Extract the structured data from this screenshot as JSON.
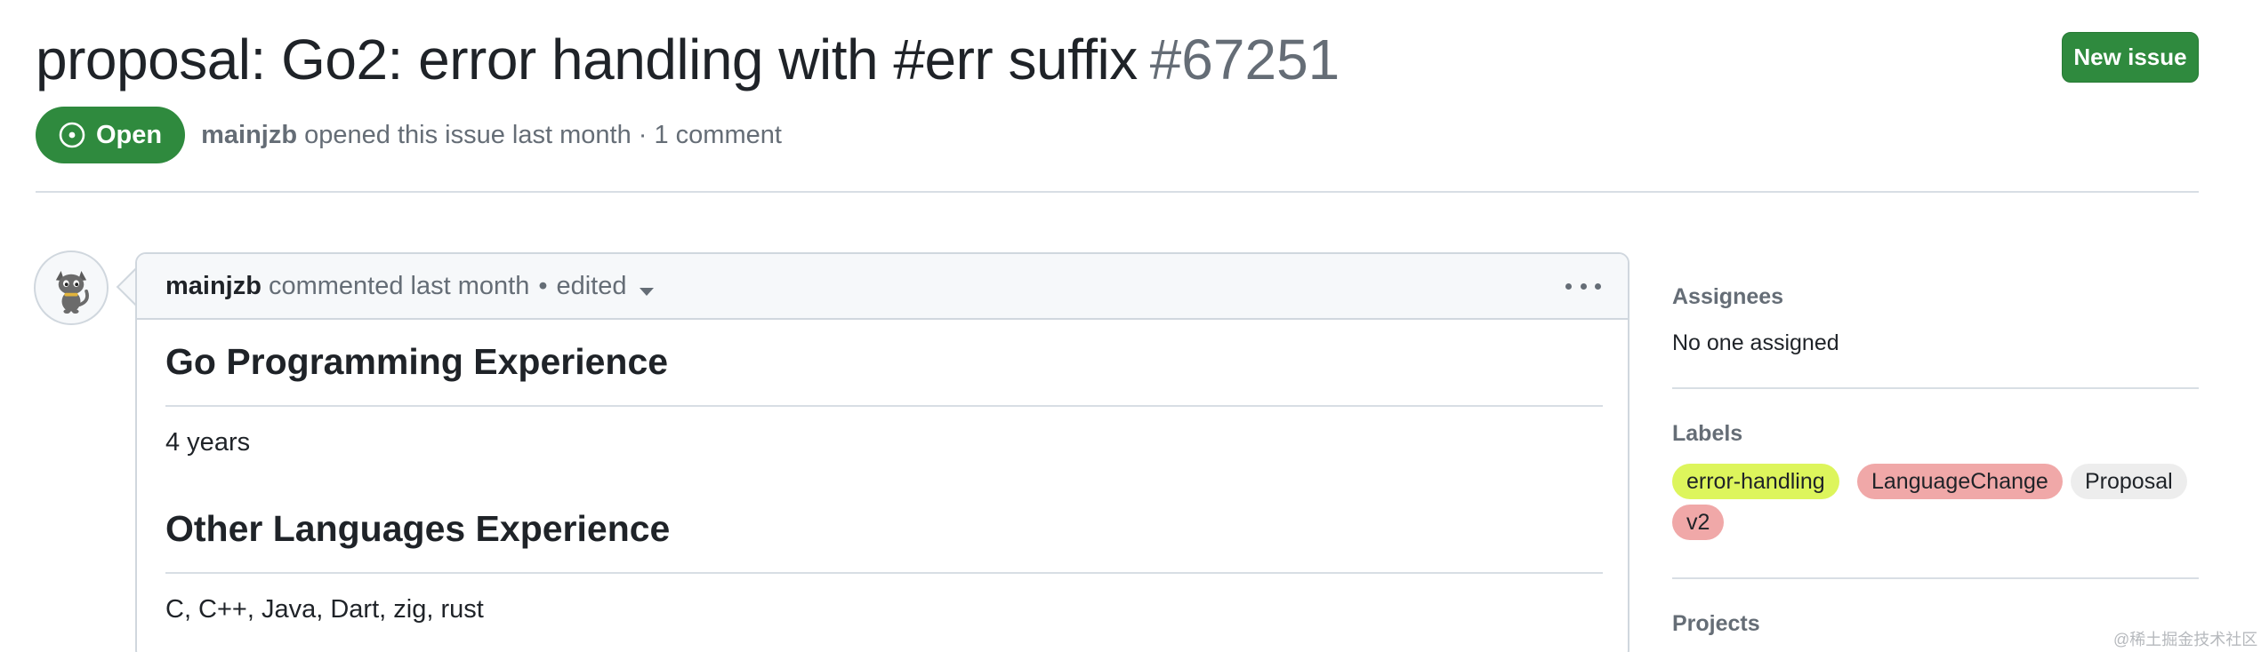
{
  "issue": {
    "title": "proposal: Go2: error handling with #err suffix",
    "number": "#67251",
    "state": "Open",
    "author": "mainjzb",
    "meta_rest": "opened this issue last month · 1 comment"
  },
  "header": {
    "new_issue_label": "New issue"
  },
  "comment": {
    "author": "mainjzb",
    "action": "commented last month",
    "separator": "•",
    "edited": "edited",
    "heading1": "Go Programming Experience",
    "answer1": "4 years",
    "heading2": "Other Languages Experience",
    "answer2": "C, C++, Java, Dart, zig, rust"
  },
  "sidebar": {
    "assignees_heading": "Assignees",
    "assignees_value": "No one assigned",
    "labels_heading": "Labels",
    "labels": [
      {
        "name": "error-handling",
        "color": "#ddf55c"
      },
      {
        "name": "LanguageChange",
        "color": "#f0a8a8"
      },
      {
        "name": "Proposal",
        "color": "#ededed"
      },
      {
        "name": "v2",
        "color": "#f0a8a8"
      }
    ],
    "projects_heading": "Projects"
  },
  "watermark": "@稀土掘金技术社区",
  "colors": {
    "open_green": "#2f8a3e",
    "muted_text": "#656d76",
    "border": "#d0d7de"
  },
  "icons": {
    "state": "issue-open-icon",
    "menu": "kebab-icon",
    "dropdown": "caret-down-icon",
    "avatar": "cat-avatar"
  }
}
